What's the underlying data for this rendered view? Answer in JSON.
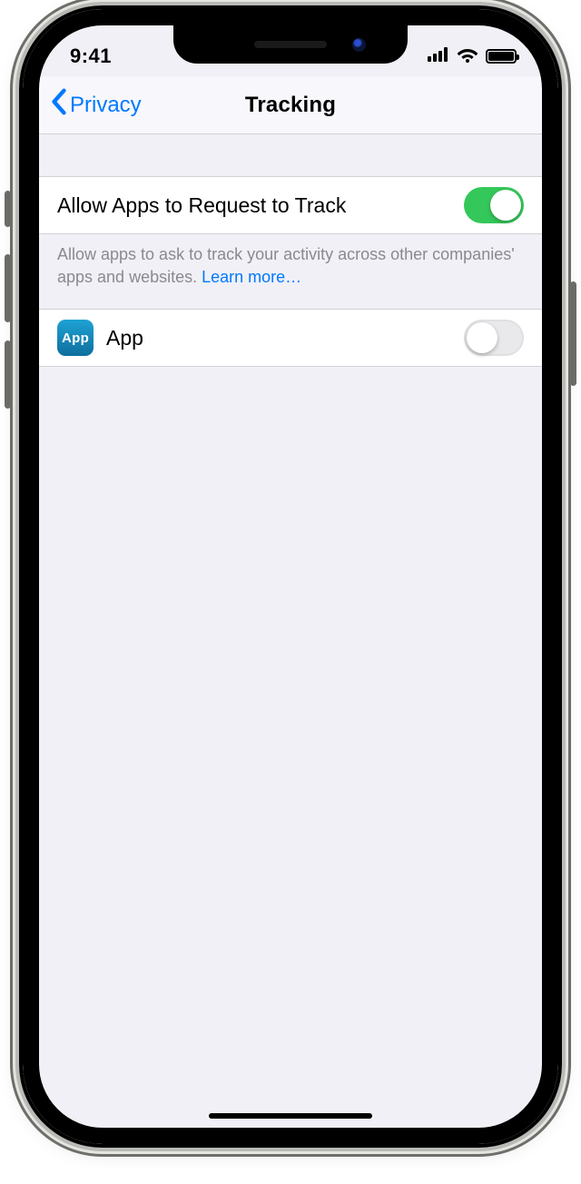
{
  "statusbar": {
    "time": "9:41"
  },
  "nav": {
    "back_label": "Privacy",
    "title": "Tracking"
  },
  "settings": {
    "allow_tracking": {
      "label": "Allow Apps to Request to Track",
      "value": true
    },
    "footer_text": "Allow apps to ask to track your activity across other companies' apps and websites. ",
    "learn_more_label": "Learn more…"
  },
  "apps": [
    {
      "icon_label": "App",
      "name": "App",
      "tracking_allowed": false
    }
  ],
  "colors": {
    "accent": "#0079ff",
    "switch_on": "#34c759"
  }
}
